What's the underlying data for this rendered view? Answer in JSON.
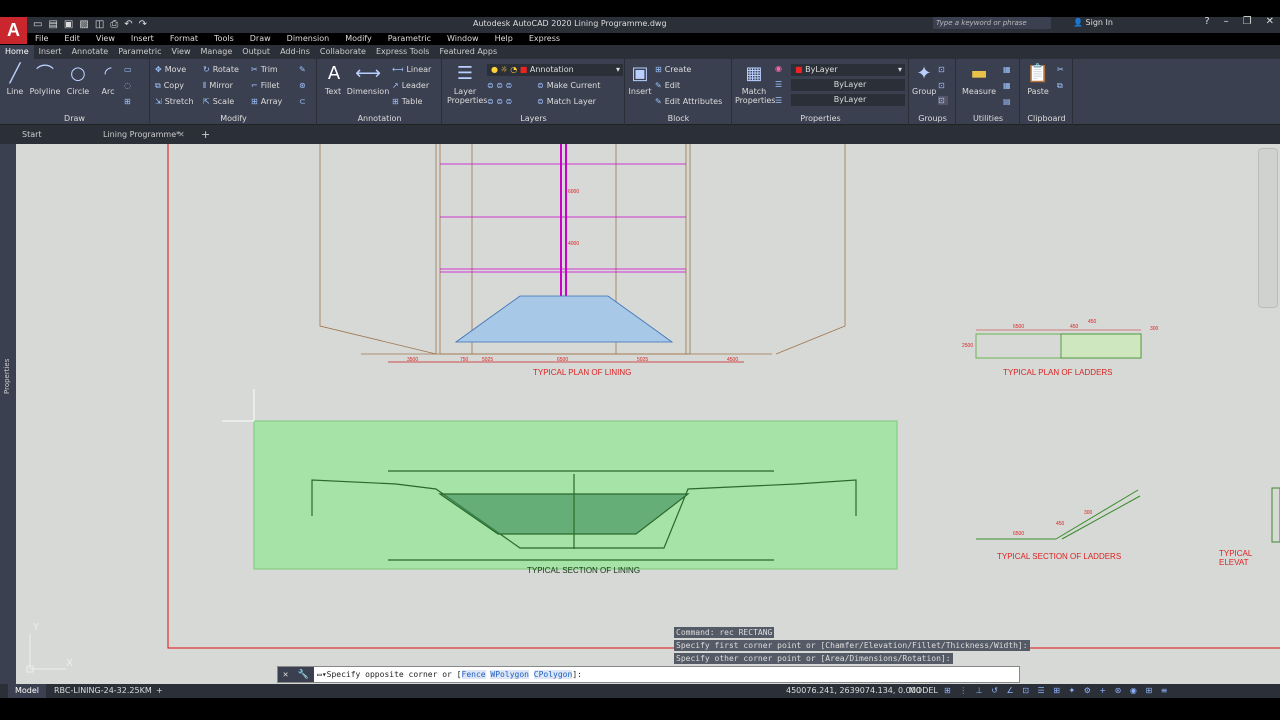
{
  "app": {
    "logo": "A",
    "title": "Autodesk AutoCAD 2020   Lining Programme.dwg"
  },
  "search": {
    "placeholder": "Type a keyword or phrase"
  },
  "user": {
    "signin": "Sign In"
  },
  "menu": [
    "File",
    "Edit",
    "View",
    "Insert",
    "Format",
    "Tools",
    "Draw",
    "Dimension",
    "Modify",
    "Parametric",
    "Window",
    "Help",
    "Express"
  ],
  "ribbon_tabs": [
    "Home",
    "Insert",
    "Annotate",
    "Parametric",
    "View",
    "Manage",
    "Output",
    "Add-ins",
    "Collaborate",
    "Express Tools",
    "Featured Apps"
  ],
  "panels": {
    "draw": {
      "title": "Draw",
      "line": "Line",
      "polyline": "Polyline",
      "circle": "Circle",
      "arc": "Arc"
    },
    "modify": {
      "title": "Modify",
      "move": "Move",
      "rotate": "Rotate",
      "trim": "Trim",
      "copy": "Copy",
      "mirror": "Mirror",
      "fillet": "Fillet",
      "stretch": "Stretch",
      "scale": "Scale",
      "array": "Array"
    },
    "annotation": {
      "title": "Annotation",
      "text": "Text",
      "dimension": "Dimension",
      "linear": "Linear",
      "leader": "Leader",
      "table": "Table"
    },
    "layers": {
      "title": "Layers",
      "layer_props": "Layer Properties",
      "current_layer": "Annotation",
      "make_current": "Make Current",
      "match_layer": "Match Layer"
    },
    "block": {
      "title": "Block",
      "insert": "Insert",
      "create": "Create",
      "edit": "Edit",
      "edit_attributes": "Edit Attributes"
    },
    "properties": {
      "title": "Properties",
      "match": "Match Properties",
      "color": "ByLayer",
      "linetype": "ByLayer",
      "lineweight": "ByLayer"
    },
    "groups": {
      "title": "Groups",
      "group": "Group"
    },
    "utilities": {
      "title": "Utilities",
      "measure": "Measure"
    },
    "clipboard": {
      "title": "Clipboard",
      "paste": "Paste"
    }
  },
  "file_tabs": {
    "start": "Start",
    "doc": "Lining Programme*"
  },
  "left_strip": "Properties",
  "drawing": {
    "plan_lining": "TYPICAL PLAN OF LINING",
    "plan_ladders": "TYPICAL PLAN OF LADDERS",
    "section_lining": "TYPICAL SECTION OF LINING",
    "section_ladders": "TYPICAL SECTION OF LADDERS",
    "elevation": "TYPICAL ELEVAT",
    "dims": {
      "d1": "3500",
      "d2": "750",
      "d3": "5025",
      "d4": "6500",
      "d5": "5025",
      "d6": "4500",
      "d7": "6500",
      "d8": "450",
      "d9": "450",
      "d10": "300",
      "d11": "2500",
      "d12": "6000",
      "d13": "4000",
      "d14": "6500",
      "d15": "450",
      "d16": "300"
    }
  },
  "ucs": {
    "x": "X",
    "y": "Y"
  },
  "command": {
    "history": [
      "Command: rec RECTANG",
      "Specify first corner point or [Chamfer/Elevation/Fillet/Thickness/Width]:",
      "Specify other corner point or [Area/Dimensions/Rotation]:"
    ],
    "prompt_pre": "Specify opposite corner or [",
    "kw1": "Fence",
    "kw2": "WPolygon",
    "kw3": "CPolygon",
    "prompt_post": "]:"
  },
  "status": {
    "model_tab": "Model",
    "layout_tab": "RBC-LINING-24-32.25KM",
    "coords": "450076.241, 2639074.134, 0.000",
    "mode": "MODEL"
  }
}
